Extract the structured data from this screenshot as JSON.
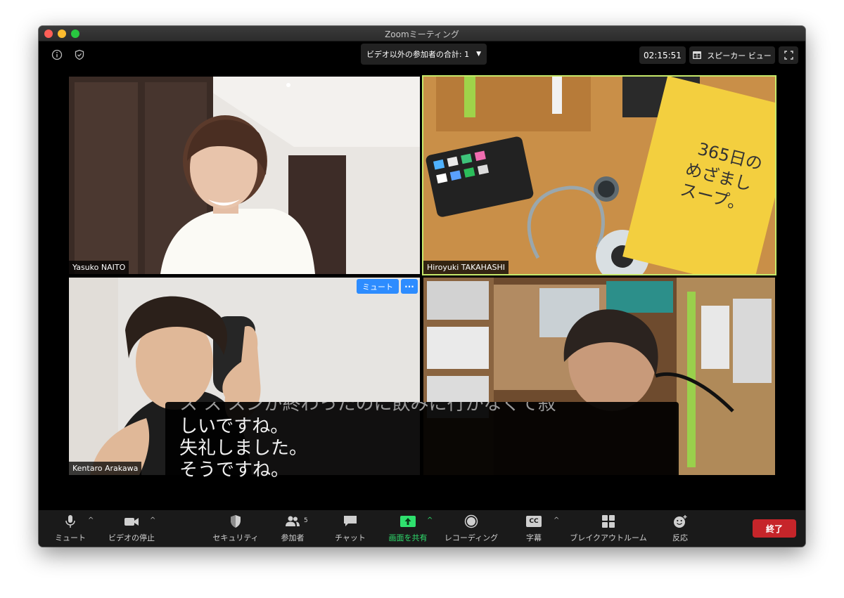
{
  "window": {
    "title": "Zoomミーティング"
  },
  "topbar": {
    "viewer_count": "ビデオ以外の参加者の合計: 1",
    "timer": "02:15:51",
    "speaker_view": "スピーカー ビュー"
  },
  "participants": [
    {
      "name": "Yasuko NAITO"
    },
    {
      "name": "Hiroyuki TAKAHASHI"
    },
    {
      "name": "Kentaro Arakawa",
      "mute_label": "ミュート",
      "more_label": "···"
    },
    {
      "name": ""
    }
  ],
  "captions": {
    "lines": [
      "ス  ス    スンが終わったのに飲みに行かなくて寂",
      "しいですね。",
      "失礼しました。",
      "そうですね。"
    ]
  },
  "toolbar": {
    "mute": "ミュート",
    "video": "ビデオの停止",
    "security": "セキュリティ",
    "participants": "参加者",
    "participants_count": "5",
    "chat": "チャット",
    "share": "画面を共有",
    "record": "レコーディング",
    "cc": "字幕",
    "cc_icon": "CC",
    "breakout": "ブレイクアウトルーム",
    "reactions": "反応",
    "end": "終了"
  },
  "colors": {
    "accent_blue": "#2d8cff",
    "active_speaker": "#c5e86a",
    "share_green": "#2fe06e",
    "end_red": "#c6252a"
  }
}
